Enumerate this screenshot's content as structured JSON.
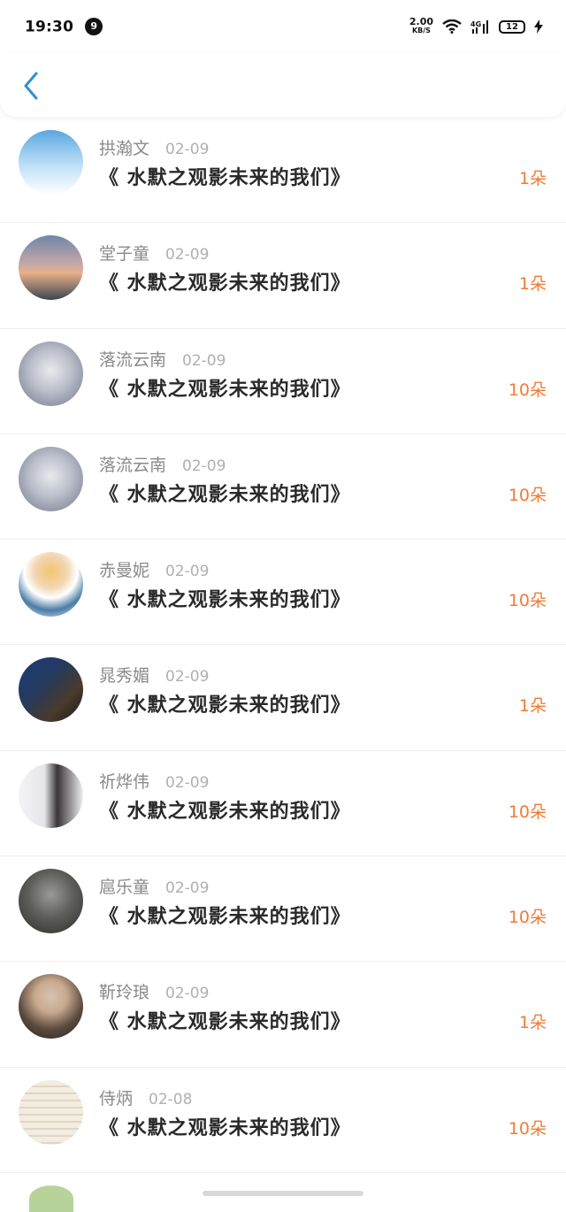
{
  "status_bar": {
    "time": "19:30",
    "notification_count": "9",
    "net_speed_value": "2.00",
    "net_speed_unit": "KB/S",
    "network_type": "4G",
    "battery_level": "12"
  },
  "header": {
    "back_icon": "chevron-left-icon",
    "accent_color": "#2f8fdc"
  },
  "colors": {
    "amount": "#f07b3a",
    "name": "#8a8a8a",
    "date": "#b0b0b0"
  },
  "items": [
    {
      "name": "拱瀚文",
      "date": "02-09",
      "title": "《 水默之观影未来的我们》",
      "amount": "1朵"
    },
    {
      "name": "堂子童",
      "date": "02-09",
      "title": "《 水默之观影未来的我们》",
      "amount": "1朵"
    },
    {
      "name": "落流云南",
      "date": "02-09",
      "title": "《 水默之观影未来的我们》",
      "amount": "10朵"
    },
    {
      "name": "落流云南",
      "date": "02-09",
      "title": "《 水默之观影未来的我们》",
      "amount": "10朵"
    },
    {
      "name": "赤曼妮",
      "date": "02-09",
      "title": "《 水默之观影未来的我们》",
      "amount": "10朵"
    },
    {
      "name": "晁秀媚",
      "date": "02-09",
      "title": "《 水默之观影未来的我们》",
      "amount": "1朵"
    },
    {
      "name": "祈烨伟",
      "date": "02-09",
      "title": "《 水默之观影未来的我们》",
      "amount": "10朵"
    },
    {
      "name": "扈乐童",
      "date": "02-09",
      "title": "《 水默之观影未来的我们》",
      "amount": "10朵"
    },
    {
      "name": "靳玲琅",
      "date": "02-09",
      "title": "《 水默之观影未来的我们》",
      "amount": "1朵"
    },
    {
      "name": "侍炳",
      "date": "02-08",
      "title": "《 水默之观影未来的我们》",
      "amount": "10朵"
    }
  ]
}
